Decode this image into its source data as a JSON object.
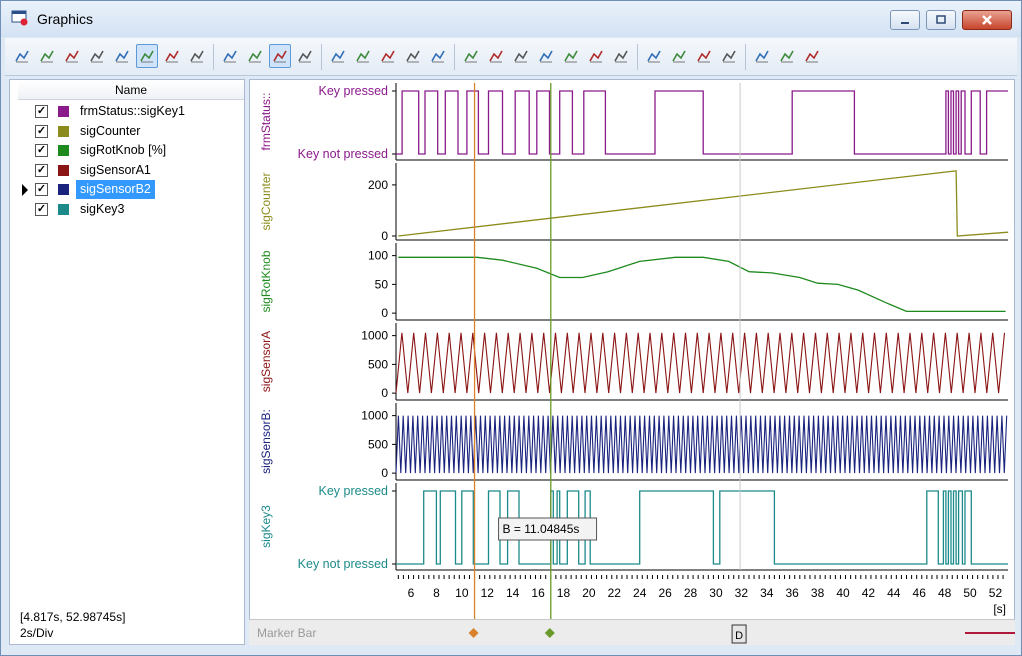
{
  "window": {
    "title": "Graphics"
  },
  "toolbar": {
    "icons": [
      "pause-icon",
      "marker-a-icon",
      "marker-b-icon",
      "fit-all-icon",
      "fit-y-icon",
      "line-mode-icon",
      "step-mode-icon",
      "x-scale-icon",
      "zoom-out-icon",
      "zoom-in-icon",
      "zoom-rect-icon",
      "zoom-fit-icon",
      "chart-a-icon",
      "chart-b-icon",
      "chart-c-icon",
      "chart-d-icon",
      "chart-e-icon",
      "signal-up-icon",
      "signal-down-icon",
      "marker-set-icon",
      "first-icon",
      "prev-icon",
      "next-icon",
      "last-icon",
      "undo-icon",
      "redo-icon",
      "axis-menu-icon",
      "grid-icon",
      "xy-icon",
      "export-icon",
      "dot-icon"
    ]
  },
  "signal_list": {
    "header": "Name",
    "items": [
      {
        "name": "frmStatus::sigKey1",
        "color": "#8b1a8b",
        "checked": true,
        "selected": false
      },
      {
        "name": "sigCounter",
        "color": "#8c8c1c",
        "checked": true,
        "selected": false
      },
      {
        "name": "sigRotKnob [%]",
        "color": "#1e8a1e",
        "checked": true,
        "selected": false
      },
      {
        "name": "sigSensorA1",
        "color": "#8b1414",
        "checked": true,
        "selected": false
      },
      {
        "name": "sigSensorB2",
        "color": "#1a237e",
        "checked": true,
        "selected": true
      },
      {
        "name": "sigKey3",
        "color": "#1c8a8a",
        "checked": true,
        "selected": false
      }
    ],
    "range": "[4.817s, 52.98745s]",
    "scale": "2s/Div"
  },
  "plots": [
    {
      "axis_label": "frmStatus::",
      "color": "#8b1a8b",
      "ticks": [
        "Key pressed",
        "Key not pressed"
      ]
    },
    {
      "axis_label": "sigCounter",
      "color": "#8c8c1c",
      "ticks": [
        "200",
        "0"
      ]
    },
    {
      "axis_label": "sigRotKnob",
      "color": "#1e8a1e",
      "ticks": [
        "100",
        "50",
        "0"
      ]
    },
    {
      "axis_label": "sigSensorA",
      "color": "#8b1414",
      "ticks": [
        "1000",
        "500",
        "0"
      ]
    },
    {
      "axis_label": "sigSensorB:",
      "color": "#1a237e",
      "ticks": [
        "1000",
        "500",
        "0"
      ]
    },
    {
      "axis_label": "sigKey3",
      "color": "#1c8a8a",
      "ticks": [
        "Key pressed",
        "Key not pressed"
      ]
    }
  ],
  "x_axis": {
    "labels": [
      "6",
      "8",
      "10",
      "12",
      "14",
      "16",
      "18",
      "20",
      "22",
      "24",
      "26",
      "28",
      "30",
      "32",
      "34",
      "36",
      "38",
      "40",
      "42",
      "44",
      "46",
      "48",
      "50",
      "52"
    ],
    "unit": "[s]",
    "range": [
      4.817,
      52.98745
    ]
  },
  "markers": {
    "a": {
      "time": 11.0,
      "color": "#d9822b"
    },
    "b": {
      "time": 17.0,
      "color": "#6a9a2a",
      "tooltip": "B = 11.04845s"
    },
    "d": {
      "time": 31.9,
      "color": "#c8c8c8",
      "label": "D"
    }
  },
  "marker_bar": {
    "label": "Marker Bar"
  },
  "chart_data": {
    "type": "line",
    "x_unit": "s",
    "xlim": [
      4.817,
      52.98745
    ],
    "series": [
      {
        "name": "frmStatus::sigKey1",
        "kind": "digital",
        "edges": [
          5.3,
          6.6,
          7.1,
          8.1,
          8.7,
          9.7,
          10.4,
          11.3,
          12.1,
          13.2,
          14.2,
          15.3,
          15.9,
          16.9,
          17.7,
          18.7,
          19.6,
          21.3,
          25.2,
          29.0,
          36.0,
          40.9,
          48.1,
          48.3,
          48.5,
          48.7,
          48.9,
          49.1,
          49.3,
          49.6,
          50.1,
          50.8,
          51.3
        ],
        "start": 0,
        "levels": [
          "Key not pressed",
          "Key pressed"
        ]
      },
      {
        "name": "sigCounter",
        "x": [
          5,
          48.9,
          49.0,
          53
        ],
        "y": [
          0,
          255,
          0,
          15
        ],
        "ylim": [
          0,
          270
        ]
      },
      {
        "name": "sigRotKnob [%]",
        "x": [
          5,
          11.2,
          13.2,
          15.9,
          17.7,
          19.5,
          21.5,
          24.0,
          26.8,
          29.0,
          31.0,
          32.6,
          34.4,
          36.6,
          38.0,
          39.6,
          41.2,
          43.4,
          45.0,
          52.8
        ],
        "y": [
          97,
          97,
          92,
          78,
          62,
          62,
          72,
          90,
          97,
          97,
          90,
          72,
          70,
          62,
          52,
          50,
          40,
          18,
          3,
          3
        ],
        "ylim": [
          -5,
          115
        ]
      },
      {
        "name": "sigSensorA1",
        "kind": "triangle",
        "min": 0,
        "max": 1050,
        "period": 0.93,
        "ylim": [
          -50,
          1150
        ]
      },
      {
        "name": "sigSensorB2",
        "kind": "triangle",
        "min": 0,
        "max": 1000,
        "period": 0.38,
        "ylim": [
          -50,
          1150
        ]
      },
      {
        "name": "sigKey3",
        "kind": "digital",
        "edges": [
          7.0,
          8.0,
          8.3,
          9.5,
          10.0,
          10.9,
          12.1,
          13.0,
          13.6,
          14.5,
          17.0,
          17.2,
          17.5,
          17.7,
          18.3,
          19.2,
          19.7,
          20.1,
          24.0,
          29.8,
          30.3,
          34.6,
          46.6,
          47.5,
          47.9,
          48.1,
          48.3,
          48.5,
          48.7,
          48.9,
          49.1,
          49.4,
          49.6,
          50.1
        ],
        "start": 0,
        "levels": [
          "Key not pressed",
          "Key pressed"
        ]
      }
    ]
  }
}
